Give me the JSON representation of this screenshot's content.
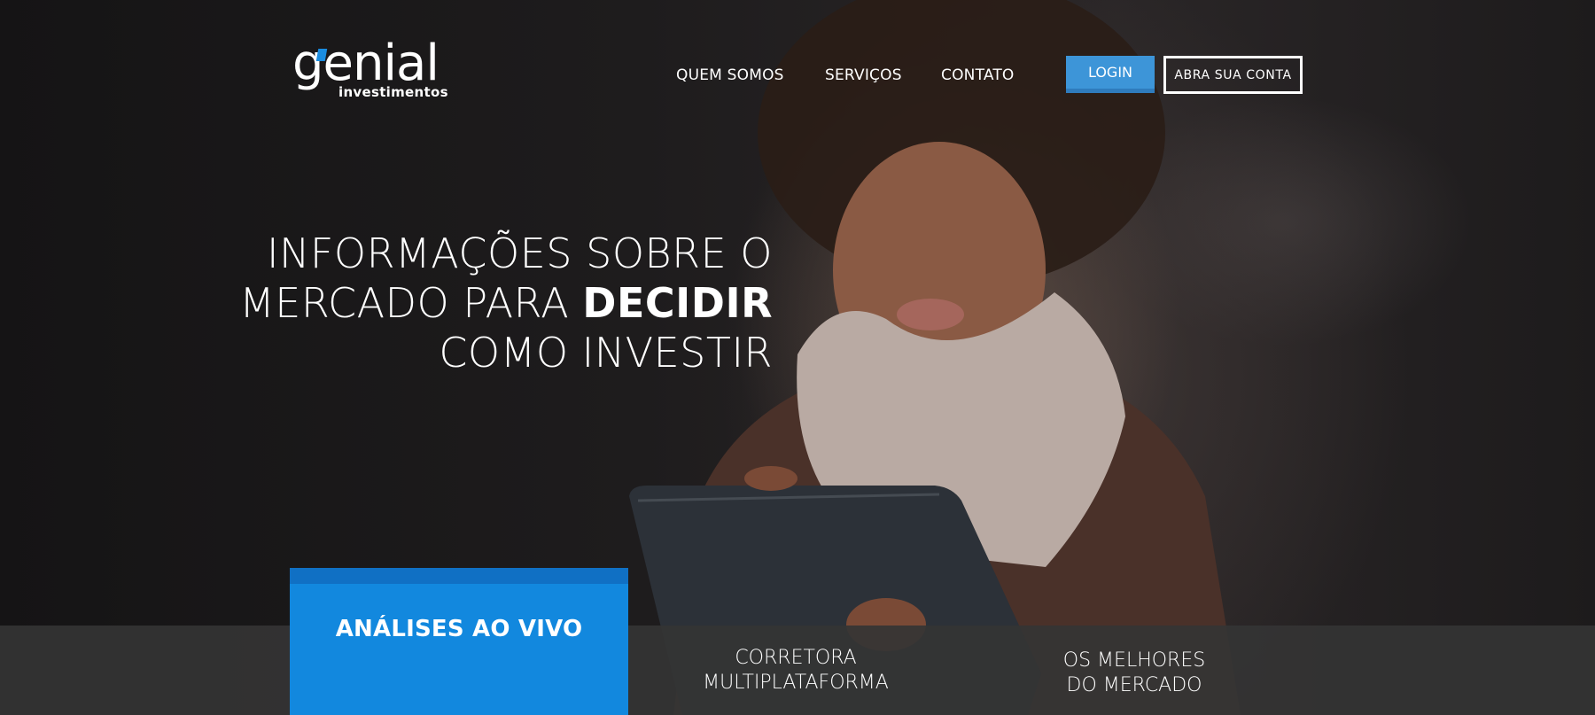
{
  "brand": {
    "logo_word": "genial",
    "logo_sub": "investimentos",
    "accent": "#1a8ce0"
  },
  "nav": {
    "items": [
      {
        "label": "QUEM SOMOS"
      },
      {
        "label": "SERVIÇOS"
      },
      {
        "label": "CONTATO"
      }
    ],
    "login_label": "LOGIN",
    "open_account_label": "ABRA SUA CONTA"
  },
  "hero": {
    "line1": "INFORMAÇÕES SOBRE O",
    "line2_prefix": "MERCADO PARA ",
    "line2_strong": "DECIDIR",
    "line3": "COMO INVESTIR"
  },
  "features": {
    "highlight": "ANÁLISES AO VIVO",
    "items": [
      {
        "line1": "CORRETORA",
        "line2": "MULTIPLATAFORMA"
      },
      {
        "line1": "OS MELHORES",
        "line2": "DO MERCADO"
      }
    ]
  },
  "colors": {
    "login_button": "#3d95d8",
    "highlight_card": "#1288de",
    "bottom_bar": "#343434"
  }
}
